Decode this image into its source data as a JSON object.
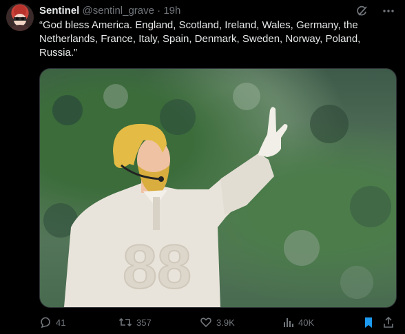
{
  "author": {
    "display_name": "Sentinel",
    "handle": "@sentinl_grave",
    "separator": "·",
    "time": "19h",
    "avatar_icon": "avatar-icon"
  },
  "tweet": {
    "text": "“God bless America. England, Scotland, Ireland, Wales, Germany, the Netherlands, France, Italy, Spain, Denmark, Sweden, Norway, Poland, Russia.”"
  },
  "media": {
    "jersey_number": "88"
  },
  "actions": {
    "replies": "41",
    "reposts": "357",
    "likes": "3.9K",
    "views": "40K"
  },
  "colors": {
    "background": "#000000",
    "text": "#e7e9ea",
    "muted": "#71767b",
    "bookmark_active": "#1d9bf0"
  },
  "icons": [
    "grok-icon",
    "more-icon",
    "reply-icon",
    "repost-icon",
    "like-icon",
    "views-icon",
    "bookmark-icon",
    "share-icon"
  ]
}
